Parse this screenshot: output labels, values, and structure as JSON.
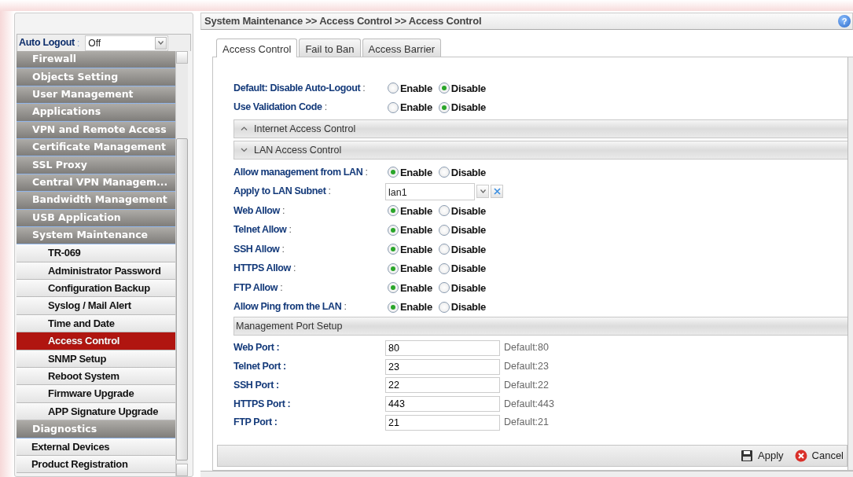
{
  "sidebar": {
    "auto_logout": {
      "label": "Auto Logout",
      "separator": ":",
      "value": "Off"
    },
    "menu": [
      {
        "kind": "group",
        "label": "Firewall",
        "selected": false
      },
      {
        "kind": "group",
        "label": "Objects Setting",
        "selected": false
      },
      {
        "kind": "group",
        "label": "User Management",
        "selected": false
      },
      {
        "kind": "group",
        "label": "Applications",
        "selected": false
      },
      {
        "kind": "group",
        "label": "VPN and Remote Access",
        "selected": false
      },
      {
        "kind": "group",
        "label": "Certificate Management",
        "selected": false
      },
      {
        "kind": "group",
        "label": "SSL Proxy",
        "selected": false
      },
      {
        "kind": "group",
        "label": "Central VPN Managem...",
        "selected": false
      },
      {
        "kind": "group",
        "label": "Bandwidth Management",
        "selected": false
      },
      {
        "kind": "group",
        "label": "USB Application",
        "selected": false
      },
      {
        "kind": "group",
        "label": "System Maintenance",
        "selected": false
      },
      {
        "kind": "sub",
        "label": "TR-069",
        "selected": false
      },
      {
        "kind": "sub",
        "label": "Administrator Password",
        "selected": false
      },
      {
        "kind": "sub",
        "label": "Configuration Backup",
        "selected": false
      },
      {
        "kind": "sub",
        "label": "Syslog / Mail Alert",
        "selected": false
      },
      {
        "kind": "sub",
        "label": "Time and Date",
        "selected": false
      },
      {
        "kind": "sub",
        "label": "Access Control",
        "selected": true
      },
      {
        "kind": "sub",
        "label": "SNMP Setup",
        "selected": false
      },
      {
        "kind": "sub",
        "label": "Reboot System",
        "selected": false
      },
      {
        "kind": "sub",
        "label": "Firmware Upgrade",
        "selected": false
      },
      {
        "kind": "sub",
        "label": "APP Signature Upgrade",
        "selected": false
      },
      {
        "kind": "group",
        "label": "Diagnostics",
        "selected": false
      },
      {
        "kind": "plain",
        "label": "External Devices",
        "selected": false
      },
      {
        "kind": "plain",
        "label": "Product Registration",
        "selected": false
      }
    ]
  },
  "main": {
    "breadcrumb": "System Maintenance >> Access Control >> Access Control",
    "help": "?",
    "tabs": [
      {
        "label": "Access Control",
        "selected": true
      },
      {
        "label": "Fail to Ban",
        "selected": false
      },
      {
        "label": "Access Barrier",
        "selected": false
      }
    ],
    "rows": [
      {
        "kind": "radio",
        "label": "Default: Disable Auto-Logout",
        "separator": ":",
        "options": [
          {
            "label": "Enable",
            "selected": false
          },
          {
            "label": "Disable",
            "selected": true
          }
        ]
      },
      {
        "kind": "radio",
        "label": "Use Validation Code",
        "separator": ":",
        "options": [
          {
            "label": "Enable",
            "selected": false
          },
          {
            "label": "Disable",
            "selected": true
          }
        ]
      }
    ],
    "sections": [
      {
        "kind": "toggle",
        "title": "Internet Access Control",
        "expanded": false
      },
      {
        "kind": "toggle",
        "title": "LAN Access Control",
        "expanded": true,
        "rows": [
          {
            "kind": "radio",
            "label": "Allow management from LAN",
            "separator": ":",
            "options": [
              {
                "label": "Enable",
                "selected": true
              },
              {
                "label": "Disable",
                "selected": false
              }
            ]
          },
          {
            "kind": "select",
            "label": "Apply to LAN Subnet",
            "separator": ":",
            "value": "lan1"
          },
          {
            "kind": "radio",
            "label": "Web Allow",
            "separator": ":",
            "options": [
              {
                "label": "Enable",
                "selected": true
              },
              {
                "label": "Disable",
                "selected": false
              }
            ]
          },
          {
            "kind": "radio",
            "label": "Telnet Allow",
            "separator": ":",
            "options": [
              {
                "label": "Enable",
                "selected": true
              },
              {
                "label": "Disable",
                "selected": false
              }
            ]
          },
          {
            "kind": "radio",
            "label": "SSH Allow",
            "separator": ":",
            "options": [
              {
                "label": "Enable",
                "selected": true
              },
              {
                "label": "Disable",
                "selected": false
              }
            ]
          },
          {
            "kind": "radio",
            "label": "HTTPS Allow",
            "separator": ":",
            "options": [
              {
                "label": "Enable",
                "selected": true
              },
              {
                "label": "Disable",
                "selected": false
              }
            ]
          },
          {
            "kind": "radio",
            "label": "FTP Allow",
            "separator": ":",
            "options": [
              {
                "label": "Enable",
                "selected": true
              },
              {
                "label": "Disable",
                "selected": false
              }
            ]
          },
          {
            "kind": "radio",
            "label": "Allow Ping from the LAN",
            "separator": ":",
            "options": [
              {
                "label": "Enable",
                "selected": true
              },
              {
                "label": "Disable",
                "selected": false
              }
            ]
          }
        ]
      },
      {
        "kind": "plain",
        "title": "Management Port Setup",
        "rows": [
          {
            "kind": "port",
            "label": "Web Port :",
            "value": "80",
            "default": "Default:80"
          },
          {
            "kind": "port",
            "label": "Telnet Port :",
            "value": "23",
            "default": "Default:23"
          },
          {
            "kind": "port",
            "label": "SSH Port :",
            "value": "22",
            "default": "Default:22"
          },
          {
            "kind": "port",
            "label": "HTTPS Port :",
            "value": "443",
            "default": "Default:443"
          },
          {
            "kind": "port",
            "label": "FTP Port :",
            "value": "21",
            "default": "Default:21"
          }
        ]
      }
    ],
    "buttons": [
      {
        "kind": "apply",
        "label": "Apply"
      },
      {
        "kind": "cancel",
        "label": "Cancel"
      }
    ]
  }
}
